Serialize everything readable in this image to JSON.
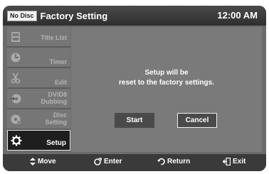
{
  "header": {
    "disc_status": "No Disc",
    "title": "Factory Setting",
    "clock": "12:00 AM"
  },
  "sidebar": {
    "items": [
      {
        "label_line1": "Title List",
        "label_line2": "",
        "icon": "film-icon",
        "active": false
      },
      {
        "label_line1": "Timer",
        "label_line2": "",
        "icon": "clock-icon",
        "active": false
      },
      {
        "label_line1": "Edit",
        "label_line2": "",
        "icon": "scissors-icon",
        "active": false
      },
      {
        "label_line1": "DV/D8",
        "label_line2": "Dubbing",
        "icon": "dubbing-disc-icon",
        "active": false
      },
      {
        "label_line1": "Disc",
        "label_line2": "Setting",
        "icon": "disc-icon",
        "active": false
      },
      {
        "label_line1": "Setup",
        "label_line2": "",
        "icon": "gear-icon",
        "active": true
      }
    ]
  },
  "dialog": {
    "message_line1": "Setup will be",
    "message_line2": "reset to the factory settings.",
    "start_label": "Start",
    "cancel_label": "Cancel"
  },
  "footer": {
    "move_label": "Move",
    "enter_label": "Enter",
    "return_label": "Return",
    "exit_label": "Exit"
  }
}
